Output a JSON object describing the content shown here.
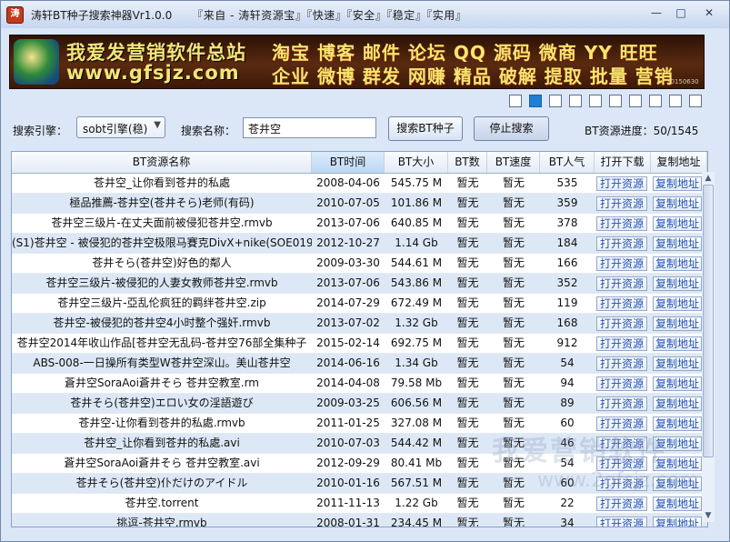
{
  "window": {
    "title": "涛轩BT种子搜索神器Vr1.0.0",
    "tagline": "『来自 - 涛轩资源宝』『快速』『安全』『稳定』『实用』",
    "app_icon_glyph": "涛",
    "min_glyph": "—",
    "max_glyph": "□",
    "close_glyph": "✕"
  },
  "banner": {
    "title_cn": "我爱发营销软件总站",
    "url": "www.gfsjz.com",
    "tags_line1": "淘宝 博客 邮件 论坛 QQ 源码 微商 YY 旺旺",
    "tags_line2": "企业 微博 群发 网赚 精品 破解 提取 批量 营销",
    "stamp": "20150630"
  },
  "pagination": {
    "count": 10,
    "active_index": 1
  },
  "search": {
    "engine_label": "搜索引擎：",
    "engine_value": "sobt引擎(稳)",
    "name_label": "搜索名称：",
    "name_value": "苍井空",
    "search_button": "搜索BT种子",
    "stop_button": "停止搜索",
    "progress_text": "BT资源进度：50/1545"
  },
  "table": {
    "columns": [
      "BT资源名称",
      "BT时间",
      "BT大小",
      "BT数",
      "BT速度",
      "BT人气",
      "打开下载",
      "复制地址"
    ],
    "open_label": "打开资源",
    "copy_label": "复制地址",
    "rows": [
      [
        "苍井空_让你看到苍井的私處",
        "2008-04-06",
        "545.75 M",
        "暂无",
        "暂无",
        "535"
      ],
      [
        "極品推薦-苍井空(苍井そら)老师(有码)",
        "2010-07-05",
        "101.86 M",
        "暂无",
        "暂无",
        "359"
      ],
      [
        "苍井空三级片-在丈夫面前被侵犯苍井空.rmvb",
        "2013-07-06",
        "640.85 M",
        "暂无",
        "暂无",
        "378"
      ],
      [
        "(S1)苍井空 - 被侵犯的苍井空极限马賽克DivX+nike(SOE019",
        "2012-10-27",
        "1.14 Gb",
        "暂无",
        "暂无",
        "184"
      ],
      [
        "苍井そら(苍井空)好色的鄰人",
        "2009-03-30",
        "544.61 M",
        "暂无",
        "暂无",
        "166"
      ],
      [
        "苍井空三级片-被侵犯的人妻女教师苍井空.rmvb",
        "2013-07-06",
        "543.86 M",
        "暂无",
        "暂无",
        "352"
      ],
      [
        "苍井空三级片-亞乱伦疯狂的羁绊苍井空.zip",
        "2014-07-29",
        "672.49 M",
        "暂无",
        "暂无",
        "119"
      ],
      [
        "苍井空-被侵犯的苍井空4小时整个强奸.rmvb",
        "2013-07-02",
        "1.32 Gb",
        "暂无",
        "暂无",
        "168"
      ],
      [
        "苍井空2014年收山作品[苍井空无乱码-苍井空76部全集种子",
        "2015-02-14",
        "692.75 M",
        "暂无",
        "暂无",
        "912"
      ],
      [
        "ABS-008-一日操所有类型W苍井空深山。美山苍井空",
        "2014-06-16",
        "1.34 Gb",
        "暂无",
        "暂无",
        "54"
      ],
      [
        "蒼井空SoraAoi蒼井そら 苍井空教室.rm",
        "2014-04-08",
        "79.58 Mb",
        "暂无",
        "暂无",
        "94"
      ],
      [
        "苍井そら(苍井空)エロい女の淫語遊び",
        "2009-03-25",
        "606.56 M",
        "暂无",
        "暂无",
        "89"
      ],
      [
        "苍井空-让你看到苍井的私處.rmvb",
        "2011-01-25",
        "327.08 M",
        "暂无",
        "暂无",
        "60"
      ],
      [
        "苍井空_让你看到苍井的私處.avi",
        "2010-07-03",
        "544.42 M",
        "暂无",
        "暂无",
        "46"
      ],
      [
        "蒼井空SoraAoi蒼井そら 苍井空教室.avi",
        "2012-09-29",
        "80.41 Mb",
        "暂无",
        "暂无",
        "54"
      ],
      [
        "苍井そら(苍井空)仆だけのアイドル",
        "2010-01-16",
        "567.51 M",
        "暂无",
        "暂无",
        "60"
      ],
      [
        "苍井空.torrent",
        "2011-11-13",
        "1.22 Gb",
        "暂无",
        "暂无",
        "22"
      ],
      [
        "挑逗-苍井空.rmvb",
        "2008-01-31",
        "234.45 M",
        "暂无",
        "暂无",
        "34"
      ]
    ]
  },
  "watermark": {
    "line1": "我爱营销软件",
    "line2": "www.2gfsjz.com"
  }
}
